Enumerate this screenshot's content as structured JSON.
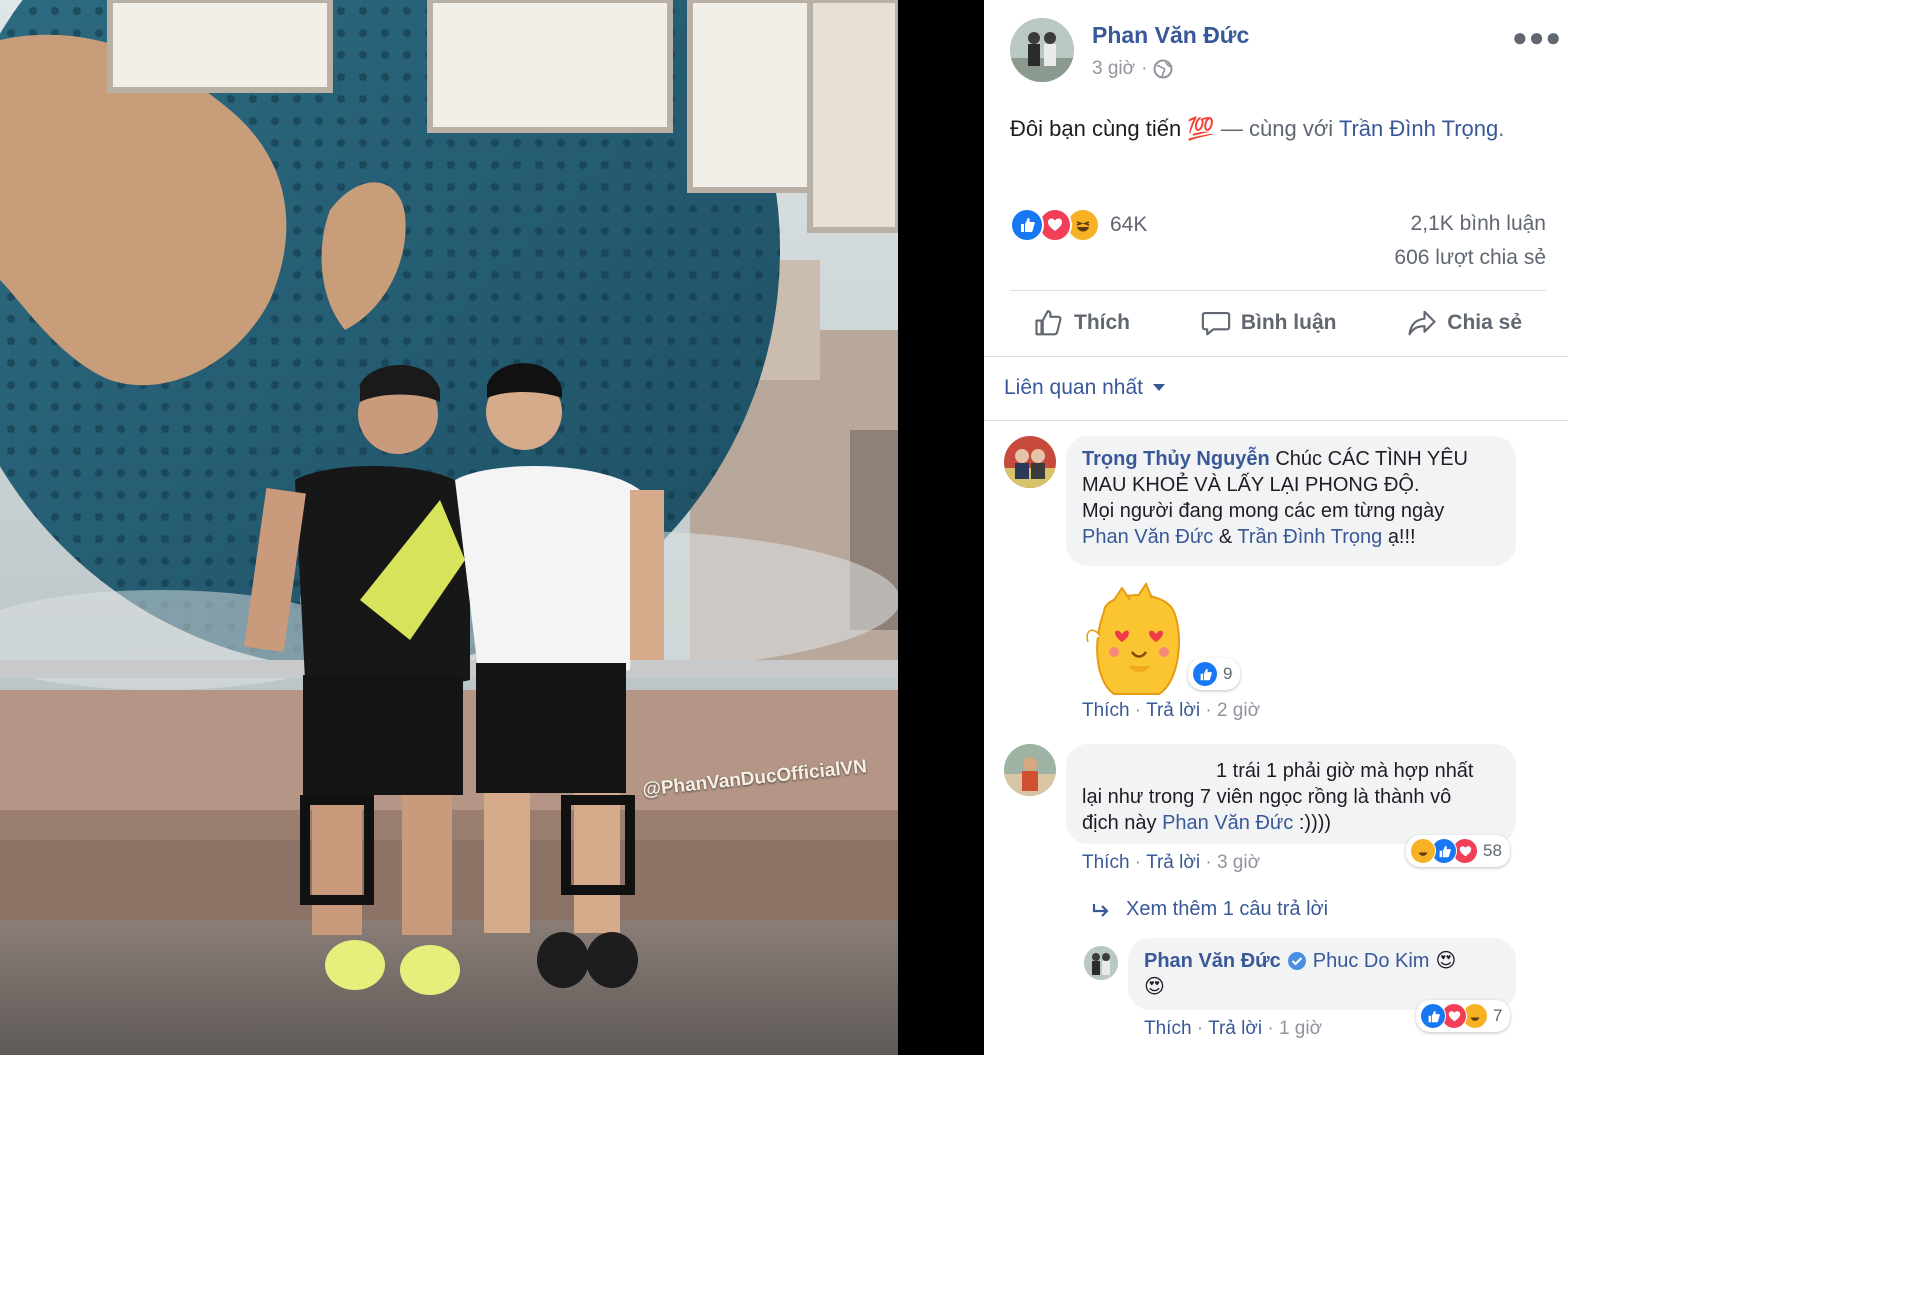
{
  "photo": {
    "watermark": "@PhanVanDucOfficialVN"
  },
  "post": {
    "author": "Phan Văn Đức",
    "time": "3 giờ",
    "caption_text": "Đôi bạn cùng tiến",
    "caption_emoji": "💯",
    "caption_with": "— cùng với",
    "tagged": "Trần Đình Trọng",
    "caption_end": ".",
    "reaction_count": "64K",
    "comments_count": "2,1K bình luận",
    "shares_count": "606 lượt chia sẻ",
    "actions": {
      "like": "Thích",
      "comment": "Bình luận",
      "share": "Chia sẻ"
    },
    "sort_label": "Liên quan nhất"
  },
  "comments": [
    {
      "author": "Trọng Thủy Nguyễn",
      "text1": "Chúc CÁC TÌNH YÊU",
      "text2": "MAU KHOẺ VÀ LẤY LẠI PHONG ĐỘ.",
      "text3": "Mọi người đang mong các em từng ngày",
      "mention1": "Phan Văn Đức",
      "amp": "&",
      "mention2": "Trần Đình Trọng",
      "text_end": "ạ!!!",
      "sticker_reactions": "9",
      "like": "Thích",
      "reply": "Trả lời",
      "time": "2 giờ"
    },
    {
      "text1": "1 trái 1 phải giờ mà hợp nhất",
      "text2": "lại như trong 7 viên ngọc rồng là thành vô",
      "text3": "địch này",
      "mention": "Phan Văn Đức",
      "text_end": ":))))",
      "reactions": "58",
      "like": "Thích",
      "reply": "Trả lời",
      "time": "3 giờ",
      "view_replies": "Xem thêm 1 câu trả lời"
    },
    {
      "author": "Phan Văn Đức",
      "mention": "Phuc Do Kim",
      "emoji": "😍",
      "reactions": "7",
      "like": "Thích",
      "reply": "Trả lời",
      "time": "1 giờ"
    }
  ],
  "colors": {
    "facebook_blue": "#385898",
    "like_blue": "#1877f2",
    "love_red": "#f33e58",
    "haha_yellow": "#f7b125"
  }
}
